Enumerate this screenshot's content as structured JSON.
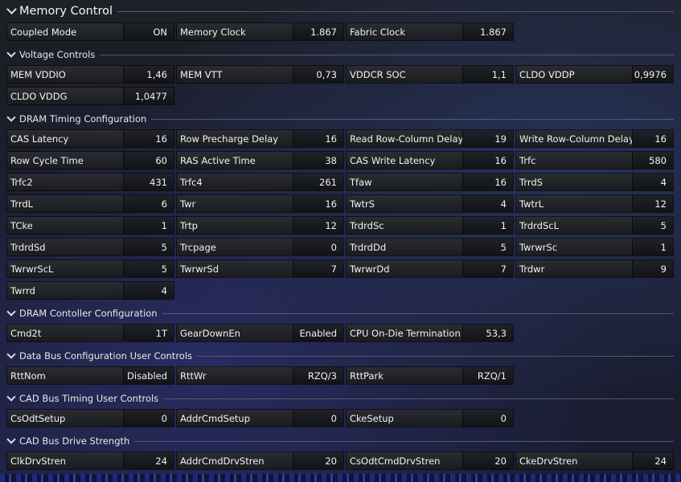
{
  "main_header": "Memory Control",
  "top_row": [
    {
      "label": "Coupled Mode",
      "value": "ON"
    },
    {
      "label": "Memory Clock",
      "value": "1.867"
    },
    {
      "label": "Fabric Clock",
      "value": "1.867"
    }
  ],
  "sections": [
    {
      "title": "Voltage Controls",
      "rows": [
        [
          {
            "label": "MEM VDDIO",
            "value": "1,46"
          },
          {
            "label": "MEM VTT",
            "value": "0,73"
          },
          {
            "label": "VDDCR SOC",
            "value": "1,1"
          },
          {
            "label": "CLDO VDDP",
            "value": "0,9976"
          }
        ],
        [
          {
            "label": "CLDO VDDG",
            "value": "1,0477"
          }
        ]
      ]
    },
    {
      "title": "DRAM Timing Configuration",
      "rows": [
        [
          {
            "label": "CAS Latency",
            "value": "16"
          },
          {
            "label": "Row Precharge Delay",
            "value": "16"
          },
          {
            "label": "Read Row-Column Delay",
            "value": "19"
          },
          {
            "label": "Write Row-Column Delay",
            "value": "16"
          }
        ],
        [
          {
            "label": "Row Cycle Time",
            "value": "60"
          },
          {
            "label": "RAS Active Time",
            "value": "38"
          },
          {
            "label": "CAS Write Latency",
            "value": "16"
          },
          {
            "label": "Trfc",
            "value": "580"
          }
        ],
        [
          {
            "label": "Trfc2",
            "value": "431"
          },
          {
            "label": "Trfc4",
            "value": "261"
          },
          {
            "label": "Tfaw",
            "value": "16"
          },
          {
            "label": "TrrdS",
            "value": "4"
          }
        ],
        [
          {
            "label": "TrrdL",
            "value": "6"
          },
          {
            "label": "Twr",
            "value": "16"
          },
          {
            "label": "TwtrS",
            "value": "4"
          },
          {
            "label": "TwtrL",
            "value": "12"
          }
        ],
        [
          {
            "label": "TCke",
            "value": "1"
          },
          {
            "label": "Trtp",
            "value": "12"
          },
          {
            "label": "TrdrdSc",
            "value": "1"
          },
          {
            "label": "TrdrdScL",
            "value": "5"
          }
        ],
        [
          {
            "label": "TrdrdSd",
            "value": "5"
          },
          {
            "label": "Trcpage",
            "value": "0"
          },
          {
            "label": "TrdrdDd",
            "value": "5"
          },
          {
            "label": "TwrwrSc",
            "value": "1"
          }
        ],
        [
          {
            "label": "TwrwrScL",
            "value": "5"
          },
          {
            "label": "TwrwrSd",
            "value": "7"
          },
          {
            "label": "TwrwrDd",
            "value": "7"
          },
          {
            "label": "Trdwr",
            "value": "9"
          }
        ],
        [
          {
            "label": "Twrrd",
            "value": "4"
          }
        ]
      ]
    },
    {
      "title": "DRAM Contoller Configuration",
      "rows": [
        [
          {
            "label": "Cmd2t",
            "value": "1T"
          },
          {
            "label": "GearDownEn",
            "value": "Enabled"
          },
          {
            "label": "CPU On-Die Termination",
            "value": "53,3"
          }
        ]
      ]
    },
    {
      "title": "Data Bus Configuration User Controls",
      "rows": [
        [
          {
            "label": "RttNom",
            "value": "Disabled"
          },
          {
            "label": "RttWr",
            "value": "RZQ/3"
          },
          {
            "label": "RttPark",
            "value": "RZQ/1"
          }
        ]
      ]
    },
    {
      "title": "CAD Bus Timing User Controls",
      "rows": [
        [
          {
            "label": "CsOdtSetup",
            "value": "0"
          },
          {
            "label": "AddrCmdSetup",
            "value": "0"
          },
          {
            "label": "CkeSetup",
            "value": "0"
          }
        ]
      ]
    },
    {
      "title": "CAD Bus Drive Strength",
      "rows": [
        [
          {
            "label": "ClkDrvStren",
            "value": "24"
          },
          {
            "label": "AddrCmdDrvStren",
            "value": "20"
          },
          {
            "label": "CsOdtCmdDrvStren",
            "value": "20"
          },
          {
            "label": "CkeDrvStren",
            "value": "24"
          }
        ]
      ]
    }
  ]
}
